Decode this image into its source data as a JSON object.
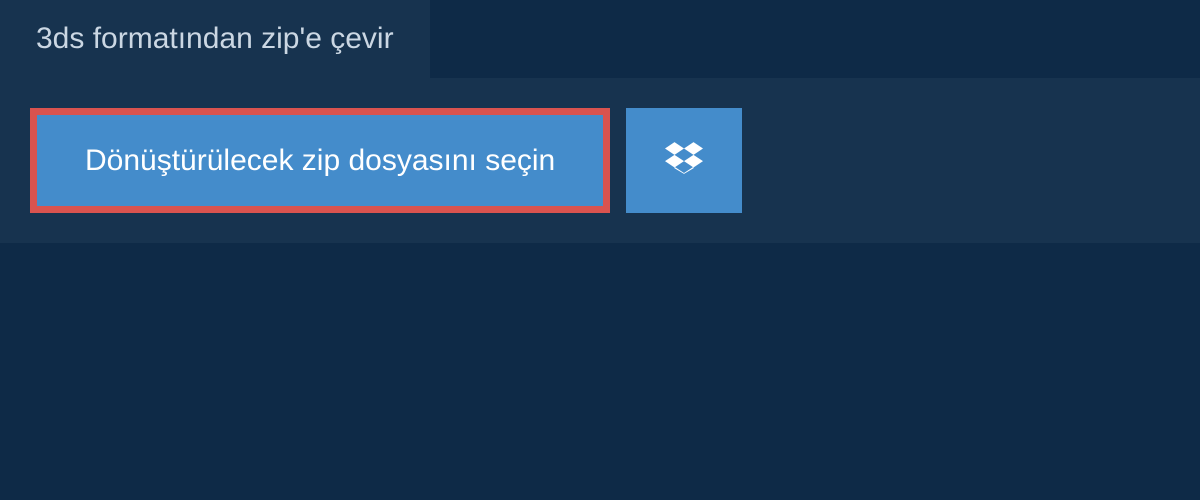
{
  "tab": {
    "label": "3ds formatından zip'e çevir"
  },
  "panel": {
    "primary_button_label": "Dönüştürülecek zip dosyasını seçin",
    "secondary_icon": "dropbox-icon"
  }
}
